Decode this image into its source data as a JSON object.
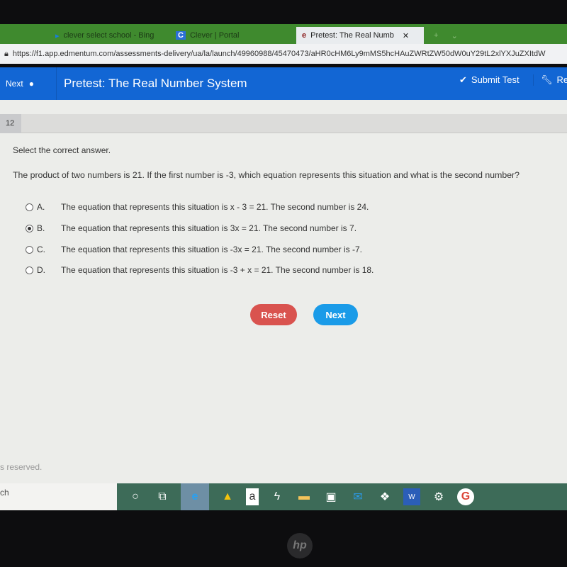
{
  "browser": {
    "tabs": [
      {
        "label": "clever select school - Bing",
        "icon": "bing-icon"
      },
      {
        "label": "Clever | Portal",
        "icon": "clever-icon"
      },
      {
        "label": "Pretest: The Real Numb",
        "icon": "edge-icon",
        "active": true
      }
    ],
    "url": "https://f1.app.edmentum.com/assessments-delivery/ua/la/launch/49960988/45470473/aHR0cHM6Ly9mMS5hcHAuZWRtZW50dW0uY29tL2xlYXJuZXItdW"
  },
  "header": {
    "next_label": "Next",
    "title": "Pretest: The Real Number System",
    "submit_label": "Submit Test",
    "tools_label": "Re",
    "color": "#1266d4"
  },
  "question": {
    "number": "12",
    "instruction": "Select the correct answer.",
    "prompt": "The product of two numbers is 21. If the first number is -3, which equation represents this situation and what is the second number?",
    "options": [
      {
        "letter": "A.",
        "text": "The equation that represents this situation is x - 3 = 21. The second number is 24.",
        "selected": false
      },
      {
        "letter": "B.",
        "text": "The equation that represents this situation is 3x = 21. The second number is 7.",
        "selected": true
      },
      {
        "letter": "C.",
        "text": "The equation that represents this situation is -3x = 21. The second number is -7.",
        "selected": false
      },
      {
        "letter": "D.",
        "text": "The equation that represents this situation is -3 + x = 21. The second number is 18.",
        "selected": false
      }
    ]
  },
  "buttons": {
    "reset": "Reset",
    "next": "Next",
    "reset_color": "#d9534f",
    "next_color": "#1a9be8"
  },
  "footer": {
    "rights": "s reserved."
  },
  "taskbar": {
    "search": "ch",
    "icons": [
      "cortana-icon",
      "task-view-icon",
      "edge-icon",
      "google-drive-icon",
      "amazon-icon",
      "bolt-icon",
      "file-explorer-icon",
      "store-icon",
      "mail-icon",
      "dropbox-icon",
      "word-icon",
      "settings-icon",
      "google-icon"
    ],
    "amazon_glyph": "a"
  },
  "bezel": {
    "logo": "hp"
  }
}
